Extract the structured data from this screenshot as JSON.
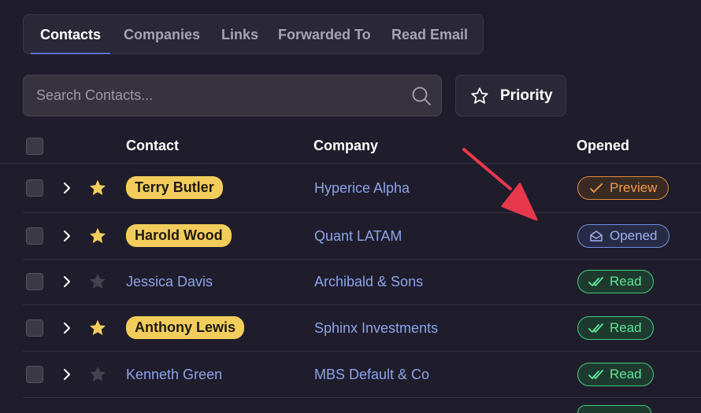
{
  "tabs": [
    {
      "label": "Contacts",
      "active": true
    },
    {
      "label": "Companies",
      "active": false
    },
    {
      "label": "Links",
      "active": false
    },
    {
      "label": "Forwarded To",
      "active": false
    },
    {
      "label": "Read Email",
      "active": false
    }
  ],
  "search": {
    "placeholder": "Search Contacts...",
    "value": ""
  },
  "priority_button": {
    "label": "Priority"
  },
  "table": {
    "headers": {
      "contact": "Contact",
      "company": "Company",
      "opened": "Opened"
    },
    "rows": [
      {
        "contact": "Terry Butler",
        "company": "Hyperice Alpha",
        "starred": true,
        "highlighted": true,
        "status": "Preview"
      },
      {
        "contact": "Harold Wood",
        "company": "Quant LATAM",
        "starred": true,
        "highlighted": true,
        "status": "Opened"
      },
      {
        "contact": "Jessica Davis",
        "company": "Archibald & Sons",
        "starred": false,
        "highlighted": false,
        "status": "Read"
      },
      {
        "contact": "Anthony Lewis",
        "company": "Sphinx Investments",
        "starred": true,
        "highlighted": true,
        "status": "Read"
      },
      {
        "contact": "Kenneth Green",
        "company": "MBS Default & Co",
        "starred": false,
        "highlighted": false,
        "status": "Read"
      }
    ]
  },
  "icons": {
    "search": "search-icon",
    "priority": "star-outline-icon",
    "expand": "chevron-right-icon",
    "star": "star-icon",
    "preview": "check-icon",
    "opened": "envelope-open-icon",
    "read": "double-check-icon"
  },
  "colors": {
    "background": "#1f1c2b",
    "star_active": "#f3cd5c",
    "star_inactive": "#45424f",
    "link": "#8ba4e8",
    "preview": "#f09a4a",
    "opened": "#9db2f0",
    "read": "#5ee699",
    "annotation_arrow": "#e8394c"
  }
}
